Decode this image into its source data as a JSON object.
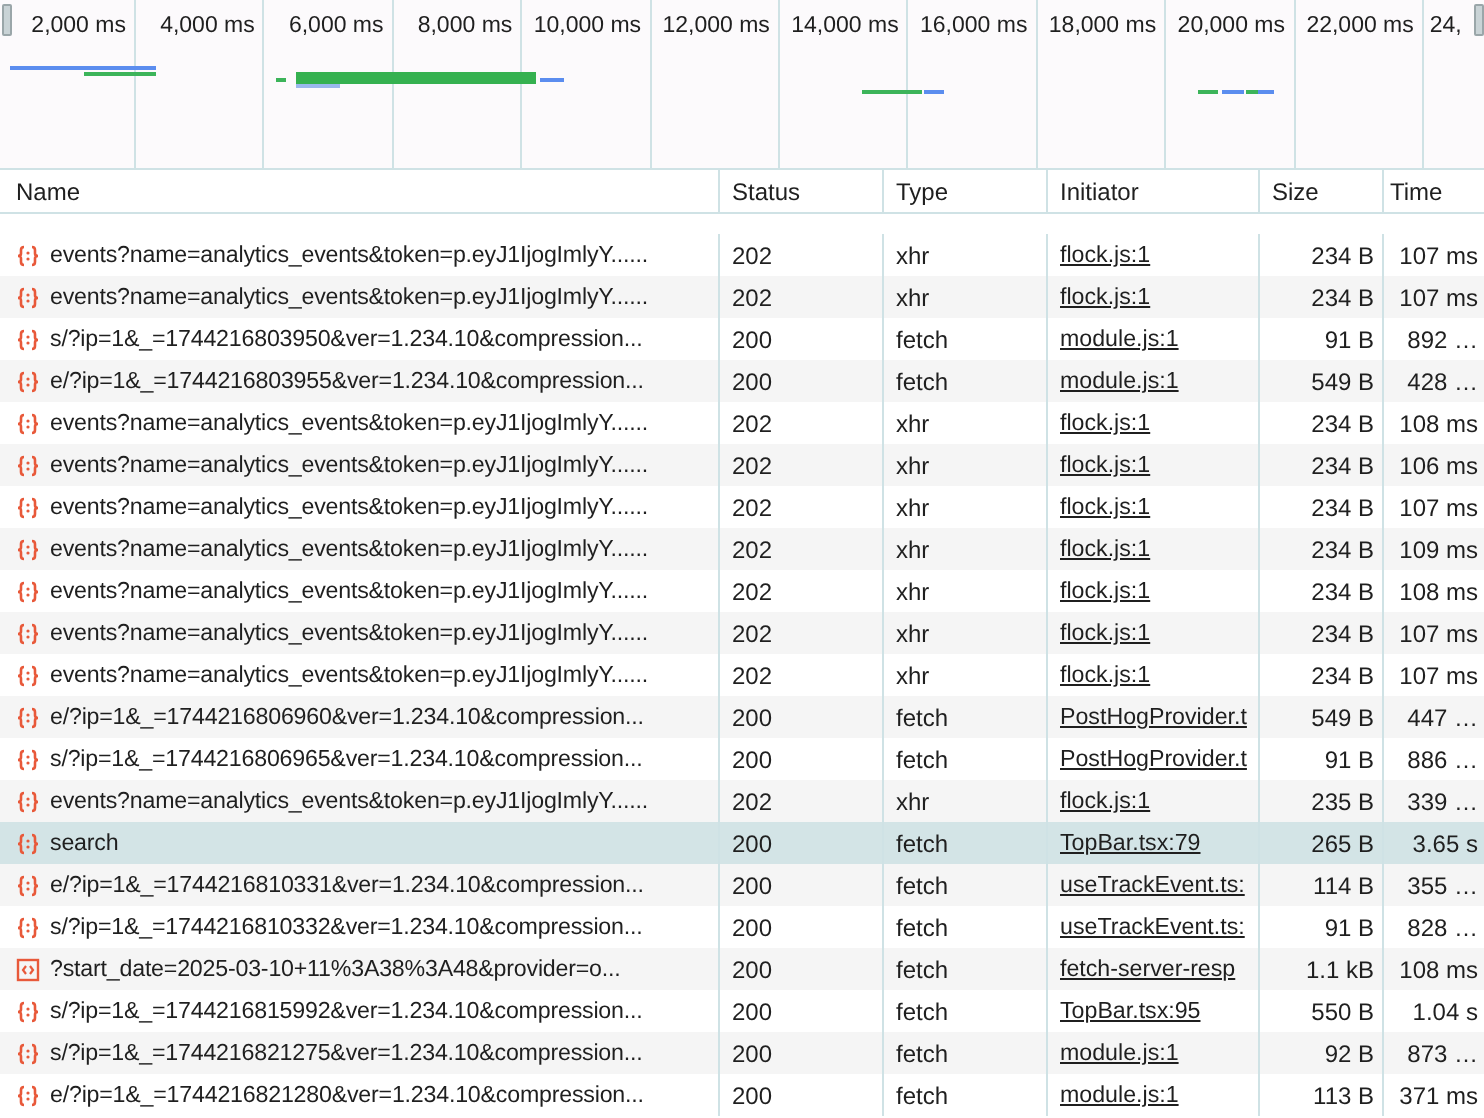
{
  "overview": {
    "ticks": [
      "2,000 ms",
      "4,000 ms",
      "6,000 ms",
      "8,000 ms",
      "10,000 ms",
      "12,000 ms",
      "14,000 ms",
      "16,000 ms",
      "18,000 ms",
      "20,000 ms",
      "22,000 ms",
      "24,"
    ]
  },
  "table": {
    "columns": [
      "Name",
      "Status",
      "Type",
      "Initiator",
      "Size",
      "Time"
    ],
    "rows": [
      {
        "kind": "script",
        "name": "events?name=analytics_events&token=p.eyJ1IjogImlyY......",
        "status": "202",
        "type": "xhr",
        "initiator": "flock.js:1",
        "size": "234 B",
        "time": "107 ms",
        "selected": false
      },
      {
        "kind": "script",
        "name": "events?name=analytics_events&token=p.eyJ1IjogImlyY......",
        "status": "202",
        "type": "xhr",
        "initiator": "flock.js:1",
        "size": "234 B",
        "time": "107 ms",
        "selected": false
      },
      {
        "kind": "script",
        "name": "s/?ip=1&_=1744216803950&ver=1.234.10&compression...",
        "status": "200",
        "type": "fetch",
        "initiator": "module.js:1",
        "size": "91 B",
        "time": "892 …",
        "selected": false
      },
      {
        "kind": "script",
        "name": "e/?ip=1&_=1744216803955&ver=1.234.10&compression...",
        "status": "200",
        "type": "fetch",
        "initiator": "module.js:1",
        "size": "549 B",
        "time": "428 …",
        "selected": false
      },
      {
        "kind": "script",
        "name": "events?name=analytics_events&token=p.eyJ1IjogImlyY......",
        "status": "202",
        "type": "xhr",
        "initiator": "flock.js:1",
        "size": "234 B",
        "time": "108 ms",
        "selected": false
      },
      {
        "kind": "script",
        "name": "events?name=analytics_events&token=p.eyJ1IjogImlyY......",
        "status": "202",
        "type": "xhr",
        "initiator": "flock.js:1",
        "size": "234 B",
        "time": "106 ms",
        "selected": false
      },
      {
        "kind": "script",
        "name": "events?name=analytics_events&token=p.eyJ1IjogImlyY......",
        "status": "202",
        "type": "xhr",
        "initiator": "flock.js:1",
        "size": "234 B",
        "time": "107 ms",
        "selected": false
      },
      {
        "kind": "script",
        "name": "events?name=analytics_events&token=p.eyJ1IjogImlyY......",
        "status": "202",
        "type": "xhr",
        "initiator": "flock.js:1",
        "size": "234 B",
        "time": "109 ms",
        "selected": false
      },
      {
        "kind": "script",
        "name": "events?name=analytics_events&token=p.eyJ1IjogImlyY......",
        "status": "202",
        "type": "xhr",
        "initiator": "flock.js:1",
        "size": "234 B",
        "time": "108 ms",
        "selected": false
      },
      {
        "kind": "script",
        "name": "events?name=analytics_events&token=p.eyJ1IjogImlyY......",
        "status": "202",
        "type": "xhr",
        "initiator": "flock.js:1",
        "size": "234 B",
        "time": "107 ms",
        "selected": false
      },
      {
        "kind": "script",
        "name": "events?name=analytics_events&token=p.eyJ1IjogImlyY......",
        "status": "202",
        "type": "xhr",
        "initiator": "flock.js:1",
        "size": "234 B",
        "time": "107 ms",
        "selected": false
      },
      {
        "kind": "script",
        "name": "e/?ip=1&_=1744216806960&ver=1.234.10&compression...",
        "status": "200",
        "type": "fetch",
        "initiator": "PostHogProvider.t",
        "size": "549 B",
        "time": "447 …",
        "selected": false
      },
      {
        "kind": "script",
        "name": "s/?ip=1&_=1744216806965&ver=1.234.10&compression...",
        "status": "200",
        "type": "fetch",
        "initiator": "PostHogProvider.t",
        "size": "91 B",
        "time": "886 …",
        "selected": false
      },
      {
        "kind": "script",
        "name": "events?name=analytics_events&token=p.eyJ1IjogImlyY......",
        "status": "202",
        "type": "xhr",
        "initiator": "flock.js:1",
        "size": "235 B",
        "time": "339 …",
        "selected": false
      },
      {
        "kind": "script",
        "name": "search",
        "status": "200",
        "type": "fetch",
        "initiator": "TopBar.tsx:79",
        "size": "265 B",
        "time": "3.65 s",
        "selected": true
      },
      {
        "kind": "script",
        "name": "e/?ip=1&_=1744216810331&ver=1.234.10&compression...",
        "status": "200",
        "type": "fetch",
        "initiator": "useTrackEvent.ts:",
        "size": "114 B",
        "time": "355 …",
        "selected": false
      },
      {
        "kind": "script",
        "name": "s/?ip=1&_=1744216810332&ver=1.234.10&compression...",
        "status": "200",
        "type": "fetch",
        "initiator": "useTrackEvent.ts:",
        "size": "91 B",
        "time": "828 …",
        "selected": false
      },
      {
        "kind": "document",
        "name": "?start_date=2025-03-10+11%3A38%3A48&provider=o...",
        "status": "200",
        "type": "fetch",
        "initiator": "fetch-server-resp",
        "size": "1.1 kB",
        "time": "108 ms",
        "selected": false
      },
      {
        "kind": "script",
        "name": "s/?ip=1&_=1744216815992&ver=1.234.10&compression...",
        "status": "200",
        "type": "fetch",
        "initiator": "TopBar.tsx:95",
        "size": "550 B",
        "time": "1.04 s",
        "selected": false
      },
      {
        "kind": "script",
        "name": "s/?ip=1&_=1744216821275&ver=1.234.10&compression...",
        "status": "200",
        "type": "fetch",
        "initiator": "module.js:1",
        "size": "92 B",
        "time": "873 …",
        "selected": false
      },
      {
        "kind": "script",
        "name": "e/?ip=1&_=1744216821280&ver=1.234.10&compression...",
        "status": "200",
        "type": "fetch",
        "initiator": "module.js:1",
        "size": "113 B",
        "time": "371 ms",
        "selected": false
      }
    ]
  }
}
